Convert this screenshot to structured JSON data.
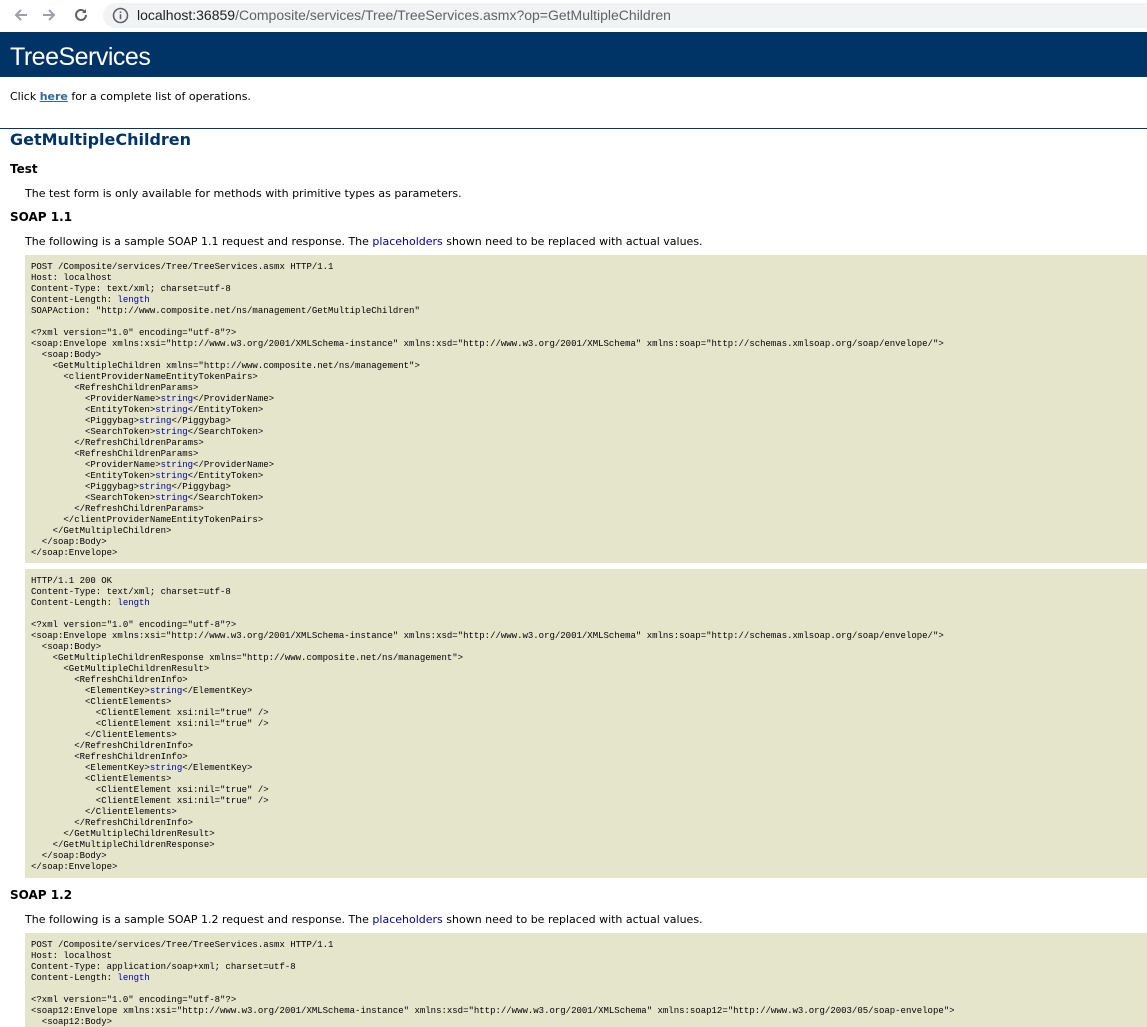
{
  "browser": {
    "url_host": "localhost:36859",
    "url_path": "/Composite/services/Tree/TreeServices.asmx?op=GetMultipleChildren"
  },
  "page": {
    "service_title": "TreeServices",
    "intro_prefix": "Click ",
    "intro_link": "here",
    "intro_suffix": " for a complete list of operations.",
    "operation_title": "GetMultipleChildren",
    "test_heading": "Test",
    "test_text": "The test form is only available for methods with primitive types as parameters.",
    "soap11_heading": "SOAP 1.1",
    "soap11_text_prefix": "The following is a sample SOAP 1.1 request and response.  The ",
    "soap12_heading": "SOAP 1.2",
    "soap12_text_prefix": "The following is a sample SOAP 1.2 request and response.  The ",
    "placeholders_word": "placeholders",
    "text_suffix": " shown need to be replaced with actual values."
  },
  "code": {
    "soap11_request": [
      [
        "POST /Composite/services/Tree/TreeServices.asmx HTTP/1.1"
      ],
      [
        "Host: localhost"
      ],
      [
        "Content-Type: text/xml; charset=utf-8"
      ],
      [
        "Content-Length: ",
        {
          "v": "length"
        }
      ],
      [
        "SOAPAction: \"http://www.composite.net/ns/management/GetMultipleChildren\""
      ],
      [
        ""
      ],
      [
        "<?xml version=\"1.0\" encoding=\"utf-8\"?>"
      ],
      [
        "<soap:Envelope xmlns:xsi=\"http://www.w3.org/2001/XMLSchema-instance\" xmlns:xsd=\"http://www.w3.org/2001/XMLSchema\" xmlns:soap=\"http://schemas.xmlsoap.org/soap/envelope/\">"
      ],
      [
        "  <soap:Body>"
      ],
      [
        "    <GetMultipleChildren xmlns=\"http://www.composite.net/ns/management\">"
      ],
      [
        "      <clientProviderNameEntityTokenPairs>"
      ],
      [
        "        <RefreshChildrenParams>"
      ],
      [
        "          <ProviderName>",
        {
          "v": "string"
        },
        "</ProviderName>"
      ],
      [
        "          <EntityToken>",
        {
          "v": "string"
        },
        "</EntityToken>"
      ],
      [
        "          <Piggybag>",
        {
          "v": "string"
        },
        "</Piggybag>"
      ],
      [
        "          <SearchToken>",
        {
          "v": "string"
        },
        "</SearchToken>"
      ],
      [
        "        </RefreshChildrenParams>"
      ],
      [
        "        <RefreshChildrenParams>"
      ],
      [
        "          <ProviderName>",
        {
          "v": "string"
        },
        "</ProviderName>"
      ],
      [
        "          <EntityToken>",
        {
          "v": "string"
        },
        "</EntityToken>"
      ],
      [
        "          <Piggybag>",
        {
          "v": "string"
        },
        "</Piggybag>"
      ],
      [
        "          <SearchToken>",
        {
          "v": "string"
        },
        "</SearchToken>"
      ],
      [
        "        </RefreshChildrenParams>"
      ],
      [
        "      </clientProviderNameEntityTokenPairs>"
      ],
      [
        "    </GetMultipleChildren>"
      ],
      [
        "  </soap:Body>"
      ],
      [
        "</soap:Envelope>"
      ]
    ],
    "soap11_response": [
      [
        "HTTP/1.1 200 OK"
      ],
      [
        "Content-Type: text/xml; charset=utf-8"
      ],
      [
        "Content-Length: ",
        {
          "v": "length"
        }
      ],
      [
        ""
      ],
      [
        "<?xml version=\"1.0\" encoding=\"utf-8\"?>"
      ],
      [
        "<soap:Envelope xmlns:xsi=\"http://www.w3.org/2001/XMLSchema-instance\" xmlns:xsd=\"http://www.w3.org/2001/XMLSchema\" xmlns:soap=\"http://schemas.xmlsoap.org/soap/envelope/\">"
      ],
      [
        "  <soap:Body>"
      ],
      [
        "    <GetMultipleChildrenResponse xmlns=\"http://www.composite.net/ns/management\">"
      ],
      [
        "      <GetMultipleChildrenResult>"
      ],
      [
        "        <RefreshChildrenInfo>"
      ],
      [
        "          <ElementKey>",
        {
          "v": "string"
        },
        "</ElementKey>"
      ],
      [
        "          <ClientElements>"
      ],
      [
        "            <ClientElement xsi:nil=\"true\" />"
      ],
      [
        "            <ClientElement xsi:nil=\"true\" />"
      ],
      [
        "          </ClientElements>"
      ],
      [
        "        </RefreshChildrenInfo>"
      ],
      [
        "        <RefreshChildrenInfo>"
      ],
      [
        "          <ElementKey>",
        {
          "v": "string"
        },
        "</ElementKey>"
      ],
      [
        "          <ClientElements>"
      ],
      [
        "            <ClientElement xsi:nil=\"true\" />"
      ],
      [
        "            <ClientElement xsi:nil=\"true\" />"
      ],
      [
        "          </ClientElements>"
      ],
      [
        "        </RefreshChildrenInfo>"
      ],
      [
        "      </GetMultipleChildrenResult>"
      ],
      [
        "    </GetMultipleChildrenResponse>"
      ],
      [
        "  </soap:Body>"
      ],
      [
        "</soap:Envelope>"
      ]
    ],
    "soap12_request": [
      [
        "POST /Composite/services/Tree/TreeServices.asmx HTTP/1.1"
      ],
      [
        "Host: localhost"
      ],
      [
        "Content-Type: application/soap+xml; charset=utf-8"
      ],
      [
        "Content-Length: ",
        {
          "v": "length"
        }
      ],
      [
        ""
      ],
      [
        "<?xml version=\"1.0\" encoding=\"utf-8\"?>"
      ],
      [
        "<soap12:Envelope xmlns:xsi=\"http://www.w3.org/2001/XMLSchema-instance\" xmlns:xsd=\"http://www.w3.org/2001/XMLSchema\" xmlns:soap12=\"http://www.w3.org/2003/05/soap-envelope\">"
      ],
      [
        "  <soap12:Body>"
      ]
    ]
  },
  "icons": {
    "back": "back-arrow-icon",
    "forward": "forward-arrow-icon",
    "reload": "reload-icon",
    "info": "info-icon"
  },
  "colors": {
    "banner": "#003366",
    "code_bg": "#e5e5cc",
    "placeholder": "#000099",
    "link": "#336699"
  }
}
